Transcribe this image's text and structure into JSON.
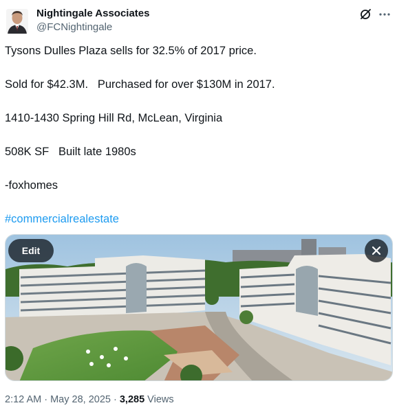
{
  "author": {
    "display_name": "Nightingale Associates",
    "handle": "@FCNightingale"
  },
  "icons": {
    "avatar": "avatar",
    "grok": "grok-icon",
    "more": "more-icon",
    "close": "close-icon"
  },
  "tweet": {
    "lines": [
      "Tysons Dulles Plaza sells for 32.5% of 2017 price.",
      "Sold for $42.3M.   Purchased for over $130M in 2017.",
      "1410-1430 Spring Hill Rd, McLean, Virginia",
      "508K SF   Built late 1980s",
      "-foxhomes"
    ],
    "hashtag": "#commercialrealestate"
  },
  "media": {
    "edit_label": "Edit"
  },
  "meta": {
    "time": "2:12 AM",
    "separator": " · ",
    "date": "May 28, 2025",
    "views_count": "3,285",
    "views_label": " Views"
  },
  "colors": {
    "link": "#1d9bf0",
    "secondary_text": "#536471",
    "primary_text": "#0f1419"
  }
}
